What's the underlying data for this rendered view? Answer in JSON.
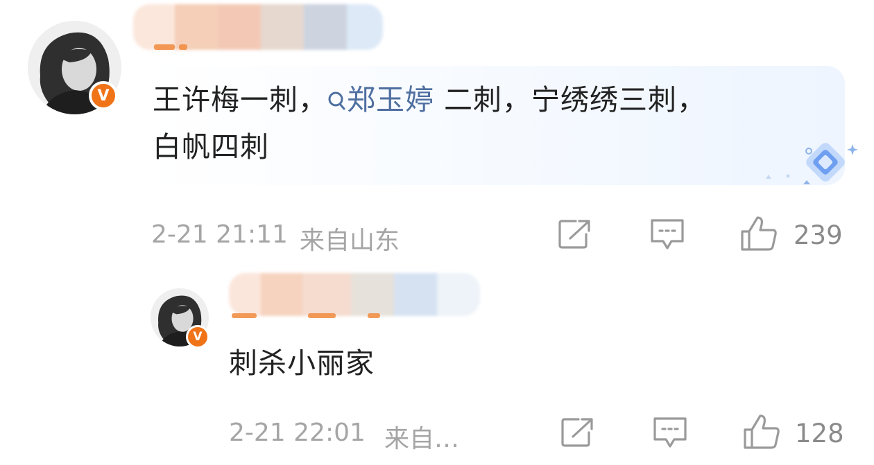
{
  "comment": {
    "text_before_mention": "王许梅一刺，",
    "mention": "郑玉婷",
    "text_after_mention": " 二刺，宁绣绣三刺，",
    "text_line2": "白帆四刺",
    "date": "2-21 21:11",
    "location": "来自山东",
    "likes": "239"
  },
  "reply": {
    "text": "刺杀小丽家",
    "date": "2-21 22:01",
    "location": "来自…",
    "likes": "128"
  },
  "badge_label": "V",
  "colors": {
    "verified_badge": "#f07318",
    "mention": "#4e6fa0",
    "meta_text": "#a5a5a5",
    "icon_stroke": "#9a9a9a"
  }
}
